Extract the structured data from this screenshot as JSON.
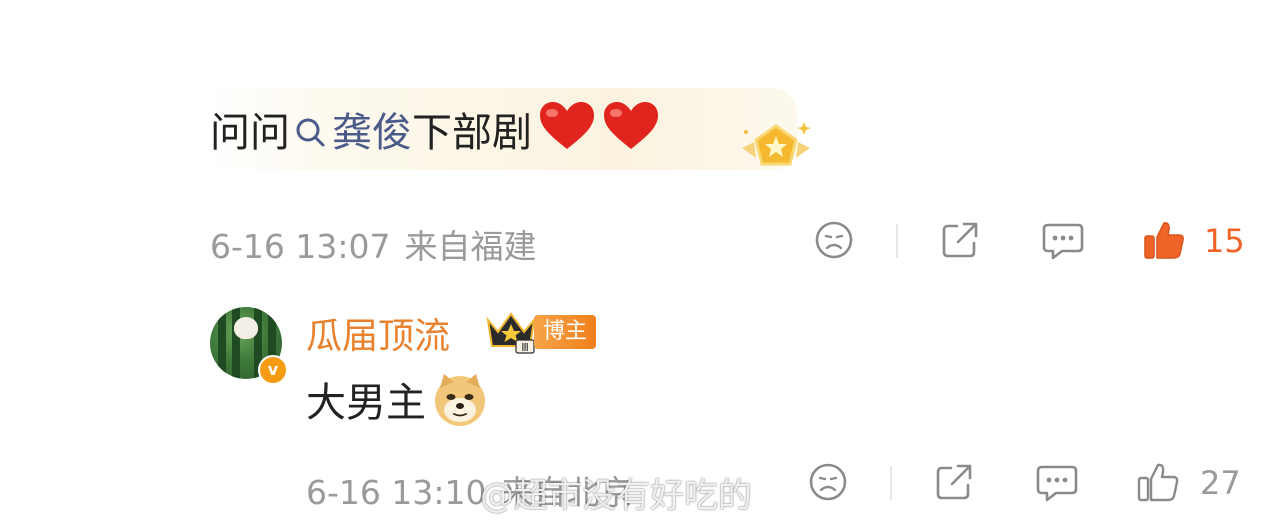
{
  "comment": {
    "prefix": "问问",
    "topic": "龚俊",
    "suffix": "下部剧",
    "emojis": [
      "heart-emoji",
      "heart-emoji"
    ],
    "date": "6-16 13:07",
    "location": "来自福建",
    "like_count": "15",
    "liked": true
  },
  "reply": {
    "username": "瓜届顶流",
    "crown_level": "Ⅲ",
    "badge": "博主",
    "text": "大男主",
    "emoji": "doge-emoji",
    "date": "6-16 13:10",
    "location": "来自北京",
    "like_count": "27",
    "liked": false
  },
  "watermark": "@超市没有好吃的",
  "colors": {
    "accent_orange": "#e8822f",
    "topic_blue": "#4a5a8a",
    "meta_gray": "#9a9a9a",
    "like_active": "#f0642a"
  }
}
